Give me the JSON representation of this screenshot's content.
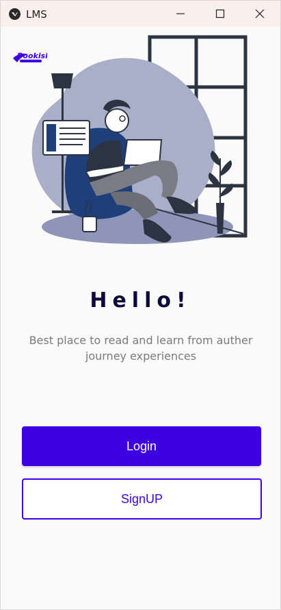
{
  "window": {
    "title": "LMS",
    "controls": {
      "minimize": "minimize-icon",
      "maximize": "maximize-icon",
      "close": "close-icon"
    }
  },
  "logo": {
    "text": "Bookish"
  },
  "main": {
    "heading": "Hello!",
    "tagline": "Best place to read and learn from auther journey experiences",
    "login_label": "Login",
    "signup_label": "SignUP"
  },
  "colors": {
    "accent": "#3d00e0",
    "heading": "#0f0a3c",
    "tagline": "#7a7a7a",
    "titlebar": "#f9efec",
    "illustration_blob": "#a9aec9",
    "illustration_navy": "#1f3f7a"
  }
}
